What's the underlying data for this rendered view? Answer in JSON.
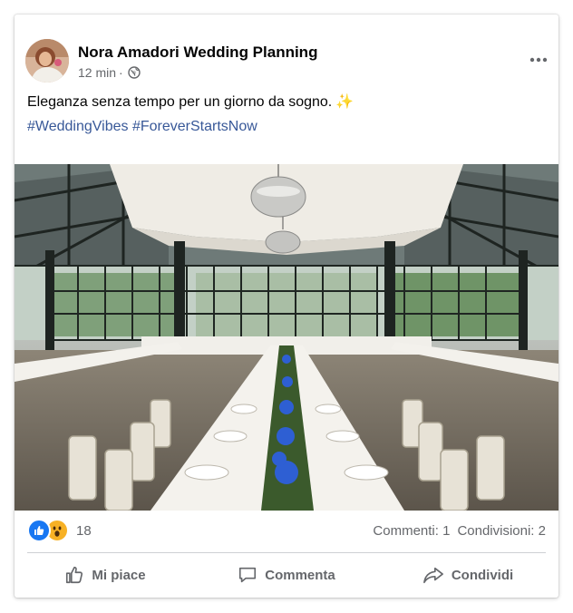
{
  "post": {
    "author": "Nora Amadori Wedding Planning",
    "time": "12 min",
    "separator": "·",
    "privacy_icon": "globe-icon",
    "caption": "Eleganza senza tempo per un giorno da sogno.",
    "caption_emoji": "✨",
    "hashtags": [
      "#WeddingVibes",
      "#ForeverStartsNow"
    ],
    "more_icon": "more-horizontal-icon"
  },
  "reactions": {
    "icons": [
      "like-reaction-icon",
      "wow-reaction-icon"
    ],
    "count": "18",
    "comments": "Commenti: 1",
    "shares": "Condivisioni: 2"
  },
  "actions": {
    "like": "Mi piace",
    "comment": "Commenta",
    "share": "Condividi"
  },
  "colors": {
    "link": "#385898",
    "like_blue": "#1877f2",
    "wow_yellow": "#f7b125",
    "secondary_text": "#65676b"
  }
}
